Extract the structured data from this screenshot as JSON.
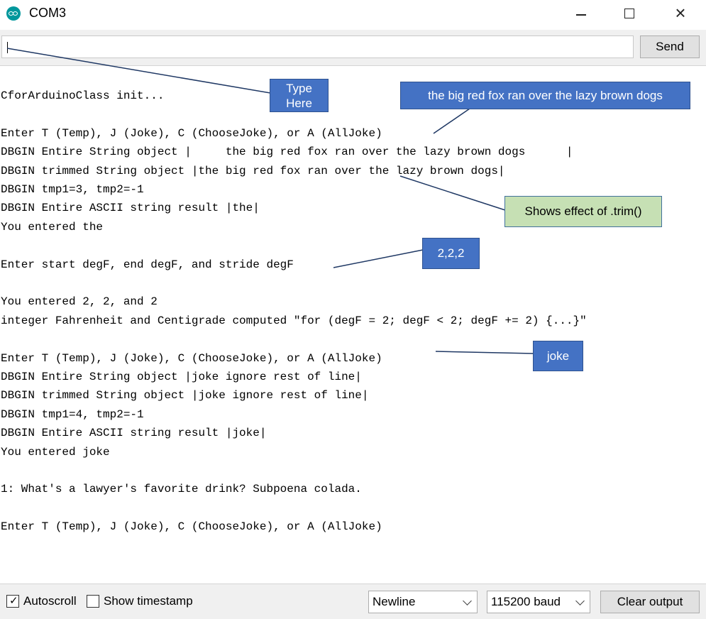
{
  "window": {
    "title": "COM3",
    "app_icon": "arduino-infinity-icon",
    "controls": {
      "minimize": "minimize-icon",
      "maximize": "maximize-icon",
      "close": "×"
    }
  },
  "toolbar": {
    "input_value": "",
    "send_label": "Send"
  },
  "output": {
    "lines": [
      "CforArduinoClass init...",
      "",
      "Enter T (Temp), J (Joke), C (ChooseJoke), or A (AllJoke)",
      "DBGIN Entire String object |     the big red fox ran over the lazy brown dogs      |",
      "DBGIN trimmed String object |the big red fox ran over the lazy brown dogs|",
      "DBGIN tmp1=3, tmp2=-1",
      "DBGIN Entire ASCII string result |the|",
      "You entered the",
      "",
      "Enter start degF, end degF, and stride degF",
      "",
      "You entered 2, 2, and 2",
      "integer Fahrenheit and Centigrade computed \"for (degF = 2; degF < 2; degF += 2) {...}\"",
      "",
      "Enter T (Temp), J (Joke), C (ChooseJoke), or A (AllJoke)",
      "DBGIN Entire String object |joke ignore rest of line|",
      "DBGIN trimmed String object |joke ignore rest of line|",
      "DBGIN tmp1=4, tmp2=-1",
      "DBGIN Entire ASCII string result |joke|",
      "You entered joke",
      "",
      "1: What's a lawyer's favorite drink? Subpoena colada.",
      "",
      "Enter T (Temp), J (Joke), C (ChooseJoke), or A (AllJoke)"
    ]
  },
  "status": {
    "autoscroll_label": "Autoscroll",
    "autoscroll_checked": true,
    "check_mark": "✓",
    "timestamp_label": "Show timestamp",
    "timestamp_checked": false,
    "line_ending": "Newline",
    "baud": "115200 baud",
    "clear_label": "Clear output"
  },
  "annotations": {
    "type_here_1": "Type",
    "type_here_2": "Here",
    "fox": "the big red fox ran over the lazy brown dogs",
    "trim": "Shows effect of .trim()",
    "deg": "2,2,2",
    "joke": "joke",
    "colors": {
      "blue_fill": "#4472c4",
      "blue_border": "#2f528f",
      "green_fill": "#c6e0b4",
      "arrow": "#1f3864"
    }
  }
}
